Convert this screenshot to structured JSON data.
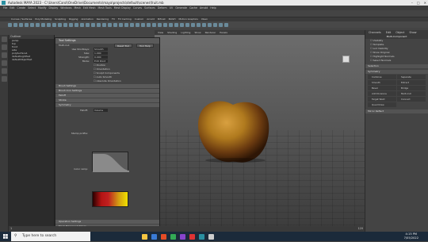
{
  "window": {
    "title": "Autodesk MAYA 2023 - C:\\Users\\Carol\\OneDrive\\Documents\\maya\\projects\\default\\scenes\\fruit.mb",
    "controls": [
      "–",
      "□",
      "✕"
    ]
  },
  "menubar": [
    "File",
    "Edit",
    "Create",
    "Select",
    "Modify",
    "Display",
    "Windows",
    "Mesh",
    "Edit Mesh",
    "Mesh Tools",
    "Mesh Display",
    "Curves",
    "Surfaces",
    "Deform",
    "UV",
    "Generate",
    "Cache",
    "Arnold",
    "Help"
  ],
  "shelf_tabs": [
    "Curves / Surfaces",
    "Poly Modeling",
    "Sculpting",
    "Rigging",
    "Animation",
    "Rendering",
    "FX",
    "FX Caching",
    "Custom",
    "Arnold",
    "Bifrost",
    "MASH",
    "Motion Graphics",
    "XGen"
  ],
  "viewport_menu": [
    "View",
    "Shading",
    "Lighting",
    "Show",
    "Renderer",
    "Panels"
  ],
  "outliner": {
    "header": "Outliner",
    "rows": [
      "persp",
      "top",
      "front",
      "side",
      "polySurface1",
      "defaultLightSet",
      "defaultObjectSet"
    ]
  },
  "tool_settings": {
    "title": "Tool Settings",
    "tool_name": "Multi-Cut",
    "reset_label": "Reset Tool",
    "help_label": "Tool Help",
    "rows": [
      {
        "label": "Use Shortkeys:",
        "value": "Smooth"
      },
      {
        "label": "Size:",
        "value": "1.000"
      },
      {
        "label": "Strength:",
        "value": "0.000"
      },
      {
        "label": "Mode:",
        "value": "Edit Point"
      }
    ],
    "checkboxes": [
      "Position",
      "Orientation",
      "Sculpt Components",
      "Auto Smooth",
      "Absolute Orientation"
    ],
    "sections": [
      "Brush Settings",
      "Brush Icon Settings",
      "Falloff",
      "Stroke",
      "Symmetry"
    ],
    "falloff_label": "Falloff:",
    "falloff_value": "Volume",
    "stamp_label": "Stamp profile:",
    "color_ramp_label": "Color ramp:",
    "lower_sections": [
      "Operation Settings",
      "Mesh Mapping Settings"
    ]
  },
  "attribute_editor": {
    "tabs": [
      "Channels",
      "Edit",
      "Object",
      "Show"
    ],
    "header": "Multi-Component",
    "rows": [
      "Visibility",
      "Template",
      "Lod Visibility",
      "Show Original",
      "Highlight Normals",
      "Select Normals"
    ],
    "sections": [
      "Selection",
      "Symmetry"
    ],
    "buttons": [
      "Combine",
      "Separate",
      "Smooth",
      "Extract",
      "Bevel",
      "Bridge",
      "Add Divisions",
      "Multi-Cut",
      "Target Weld",
      "Connect",
      "Quad Draw"
    ],
    "bottom_label": "Mirror Reflect"
  },
  "time_slider": {
    "start": "1",
    "end": "120",
    "current": "1"
  },
  "taskbar": {
    "search_placeholder": "Type here to search",
    "time": "4:15 PM",
    "date": "7/05/2022"
  },
  "colors": {
    "accent": "#2a8fa0",
    "taskbar": "#1b2a3a",
    "viewport_top": "#6c6c6c",
    "viewport_bottom": "#3c3c3c"
  },
  "icons": [
    "maya-logo-icon",
    "search-icon",
    "view-cube-icon",
    "windows-start-icon",
    "minimize-icon",
    "maximize-icon",
    "close-icon"
  ]
}
